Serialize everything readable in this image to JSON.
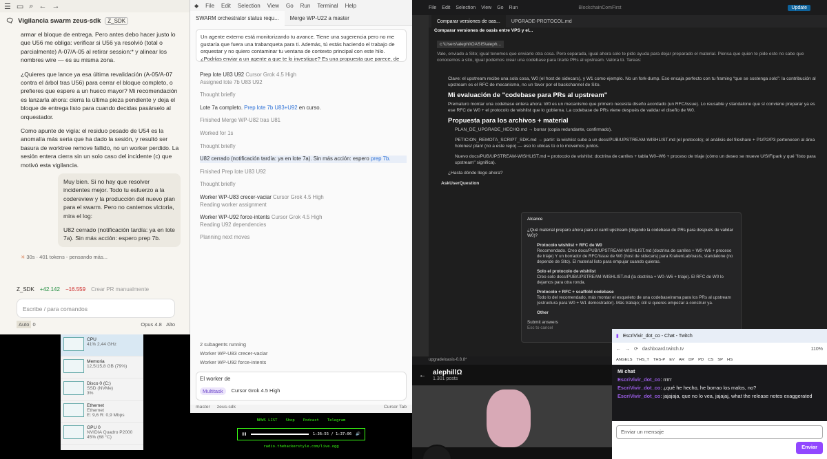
{
  "w1": {
    "title": "Vigilancia swarm zeus-sdk",
    "tag": "Z_SDK",
    "p0": "armar el bloque de entrega. Pero antes debo hacer justo lo que U56 me obliga: verificar si U56 ya resolvió (total o parcialmente) A-07/A-05 al retirar session:* y alinear los nombres wire — es su misma zona.",
    "p1": "¿Quieres que lance ya esa última revalidación (A-05/A-07 contra el árbol tras U56) para cerrar el bloque completo, o prefieres que espere a un hueco mayor? Mi recomendación es lanzarla ahora: cierra la última pieza pendiente y deja el bloque de entrega listo para cuando decidas pasárselo al orquestador.",
    "p2": "Como apunte de vigía: el residuo pesado de U54 es la anomalía más seria que ha dado la sesión, y resultó ser basura de worktree remove fallido, no un worker perdido. La sesión entera cierra sin un solo caso del incidente (c) que motivó esta vigilancia.",
    "user_msg1": "Muy bien. Si no hay que resolver incidentes mejor. Todo tu esfuerzo a la codereview y la producción del nuevo plan para el swarm. Pero no cantemos victoria, mira el log:",
    "user_msg2": "U82 cerrado (notificación tardía: ya en lote 7a). Sin más acción: espero prep 7b.",
    "thinking": "30s · 401 tokens - pensando más...",
    "branch": "Z_SDK",
    "added": "+42.142",
    "removed": "−16.559",
    "pr_button": "Crear PR manualmente",
    "placeholder": "Escribe / para comandos",
    "mode": "Auto",
    "count": "0",
    "model": "Opus 4.8",
    "effort": "Alto"
  },
  "w2": {
    "menu": [
      "File",
      "Edit",
      "Selection",
      "View",
      "Go",
      "Run",
      "Terminal",
      "Help"
    ],
    "tab1": "SWARM orchestrator status requ...",
    "tab2": "Merge WP-U22 a master",
    "message": "Un agente externo está monitorizando tu avance. Tiene una sugerencia pero no me gustaría que fuera una trabanqueta para ti. Además, tú estás haciendo el trabajo de orquestar y no quiero contaminar tu ventana de contexto principal con este hilo. ¿Podrías enviar a un agente a que te lo investigue? Es una propuesta que parece, de aplicarse, se",
    "l1": "Prep lote U83 U92",
    "l1m": "Cursor Grok 4.5 High",
    "l1s": "Assigned lote 7b U83 U92",
    "thought": "Thought",
    "briefly": "briefly",
    "lote_complete": "Lote 7a completo.",
    "lote_link": "Prep lote 7b U83+U92",
    "lote_after": "en curso.",
    "finished1": "Finished Merge WP-U82 tras U81",
    "worked": "Worked for 1s",
    "u82": "U82 cerrado (notificación tardía: ya en lote 7a). Sin más acción: espero",
    "u82_link": "prep 7b.",
    "finished2": "Finished Prep lote U83 U92",
    "worker1": "Worker WP-U83 crecer-vaciar",
    "worker1m": "Cursor Grok 4.5 High",
    "worker1s": "Reading worker assignment",
    "worker2": "Worker WP-U92 force-intents",
    "worker2m": "Cursor Grok 4.5 High",
    "worker2s": "Reading U92 dependencies",
    "planning": "Planning next moves",
    "subagents": "2 subagents running",
    "sub1": "Worker WP-U83 crecer-vaciar",
    "sub2": "Worker WP-U92 force-intents",
    "composer": "El worker de",
    "mode": "Multitask",
    "model": "Cursor Grok 4.5 High",
    "status": [
      "master",
      "zeus-sdk",
      "Cursor Tab"
    ]
  },
  "w3": {
    "menu": [
      "File",
      "Edit",
      "Selection",
      "View",
      "Go",
      "Run"
    ],
    "window_title": "BlockchainComFirst",
    "update": "Update",
    "tab1": "Comparar versiones de oas...",
    "tab2": "UPGRADE-PROTOCOL.md",
    "header": "Comparar versiones de oasis entre VPS y el...",
    "path": "c:\\Users\\alephi\\OASIS\\aleph...",
    "intro": "Vale, enviado a Sito; igual tenemos que enviarle otra cosa. Pero separada, igual ahora solo te pido ayuda para dejar preparado el material. Piensa que quien te pide esto no sabe que conocemos a sito, igual podemos crear una codebase para tirarle PRs al upstream. Valora tú. Tareas:",
    "clave": "Clave: el upstream recibe una sola cosa, W0 (el host de sidecars), y W1 como ejemplo. No un fork-dump. Eso encaja perfecto con tu framing “que se sostenga solo”: la contribución al upstream es el RFC de mecanismo, no un favor por el backchannel de Sito.",
    "h1": "Mi evaluación de \"codebase para PRs al upstream\"",
    "eval": "Prematuro montar una codebase entera ahora: W0 es un mecanismo que primero necesita diseño acordado (un RFC/issue). Lo reusable y standalone que sí conviene preparar ya es ese RFC de W0 + el protocolo de wishlist que lo gobierna. La codebase de PRs viene después de validar el diseño de W0.",
    "h2": "Propuesta para los archivos + material",
    "b1": "PLAN_DE_UPGRADE_HECHO.md → borrar (copia redundante, confirmado).",
    "b2": "PETICION_REMOTA_SCRIPT_SDK.md → partir: la wishlist sube a un docs/PUB/UPSTREAM-WISHLIST.md (el protocolo); el análisis del fileshare + P1/P2/P3 pertenecen al área holones/ plan/ (no a este repo) — eso lo ubicas tú o lo movemos juntos.",
    "b3": "Nuevo docs/PUB/UPSTREAM-WISHLIST.md = protocolo de wishlist: doctrina de carriles + tabla W0–W6 + proceso de triaje (cómo un deseo se mueve U/S/F/park y qué \"listo para upstream\" significa).",
    "ask": "¿Hasta dónde llego ahora?",
    "tool": "AskUserQuestion",
    "dlg_title": "Alcance",
    "dlg_q": "¿Qué material preparo ahora para el carril upstream (dejando la codebase de PRs para después de validar W0)?",
    "o1": "Protocolo wishlist + RFC de W0",
    "o1d": "Recomendado. Creo docs/PUB/UPSTREAM-WISHLIST.md (doctrina de carriles + W0–W6 + proceso de triaje) Y un borrador de RFC/issue de W0 (host de sidecars) para KrakenLab/oasis, standalone (no depende de Sito). El material listo para empujar cuando quieras.",
    "o2": "Solo el protocolo de wishlist",
    "o2d": "Creo solo docs/PUB/UPSTREAM-WISHLIST.md (la doctrina + W0–W6 + triaje). El RFC de W0 lo dejamos para otra ronda.",
    "o3": "Protocolo + RFC + scaffold codebase",
    "o3d": "Todo lo del recomendado, más montar el esqueleto de una codebase/rama para los PRs al upstream (estructura para W0 + W1 demostrador). Más trabajo; útil si quieres empezar a construir ya.",
    "o4": "Other",
    "submit": "Submit answers",
    "cancel": "Esc to cancel",
    "status": "upgrade/oasis-0.8.8*"
  },
  "w4": {
    "items": [
      {
        "name": "CPU",
        "d1": "41% 2,44 GHz",
        "d2": ""
      },
      {
        "name": "Memoria",
        "d1": "12,5/15,8 GB (79%)",
        "d2": ""
      },
      {
        "name": "Disco 0 (C:)",
        "d1": "SSD (NVMe)",
        "d2": "3%"
      },
      {
        "name": "Ethernet",
        "d1": "Ethernet",
        "d2": "E: 9,6 R: 0,9 Mbps"
      },
      {
        "name": "GPU 0",
        "d1": "NVIDIA Quadro P2000",
        "d2": "45% (68 °C)"
      }
    ]
  },
  "w5": {
    "links": [
      "NEWS LIST",
      "Shop",
      "Podcast",
      "Telegram"
    ],
    "time": "1:36:55 / 1:37:06",
    "stream": "radio.thehackerstyle.com/live.ogg"
  },
  "w6": {
    "name": "alephillΩ",
    "posts": "1.301 posts"
  },
  "w7": {
    "tab": "EscriVivir_dot_co - Chat - Twitch",
    "url": "dashboard.twitch.tv",
    "zoom": "110%",
    "bookmarks": [
      "ANGELS",
      "THS_T",
      "THS-P",
      "EV",
      "AR",
      "DP",
      "PD",
      "CS",
      "SP",
      "HS"
    ],
    "header": "Mi chat",
    "messages": [
      {
        "user": "EscriVivir_dot_co",
        "text": "rrrrr"
      },
      {
        "user": "EscriVivir_dot_co",
        "text": "¿qué he hecho, he borrao los malos, no?"
      },
      {
        "user": "EscriVivir_dot_co",
        "text": "jajajaja, que no lo vea, jajajaj, what the release notes exaggerated"
      }
    ],
    "placeholder": "Enviar un mensaje",
    "send": "Enviar"
  }
}
